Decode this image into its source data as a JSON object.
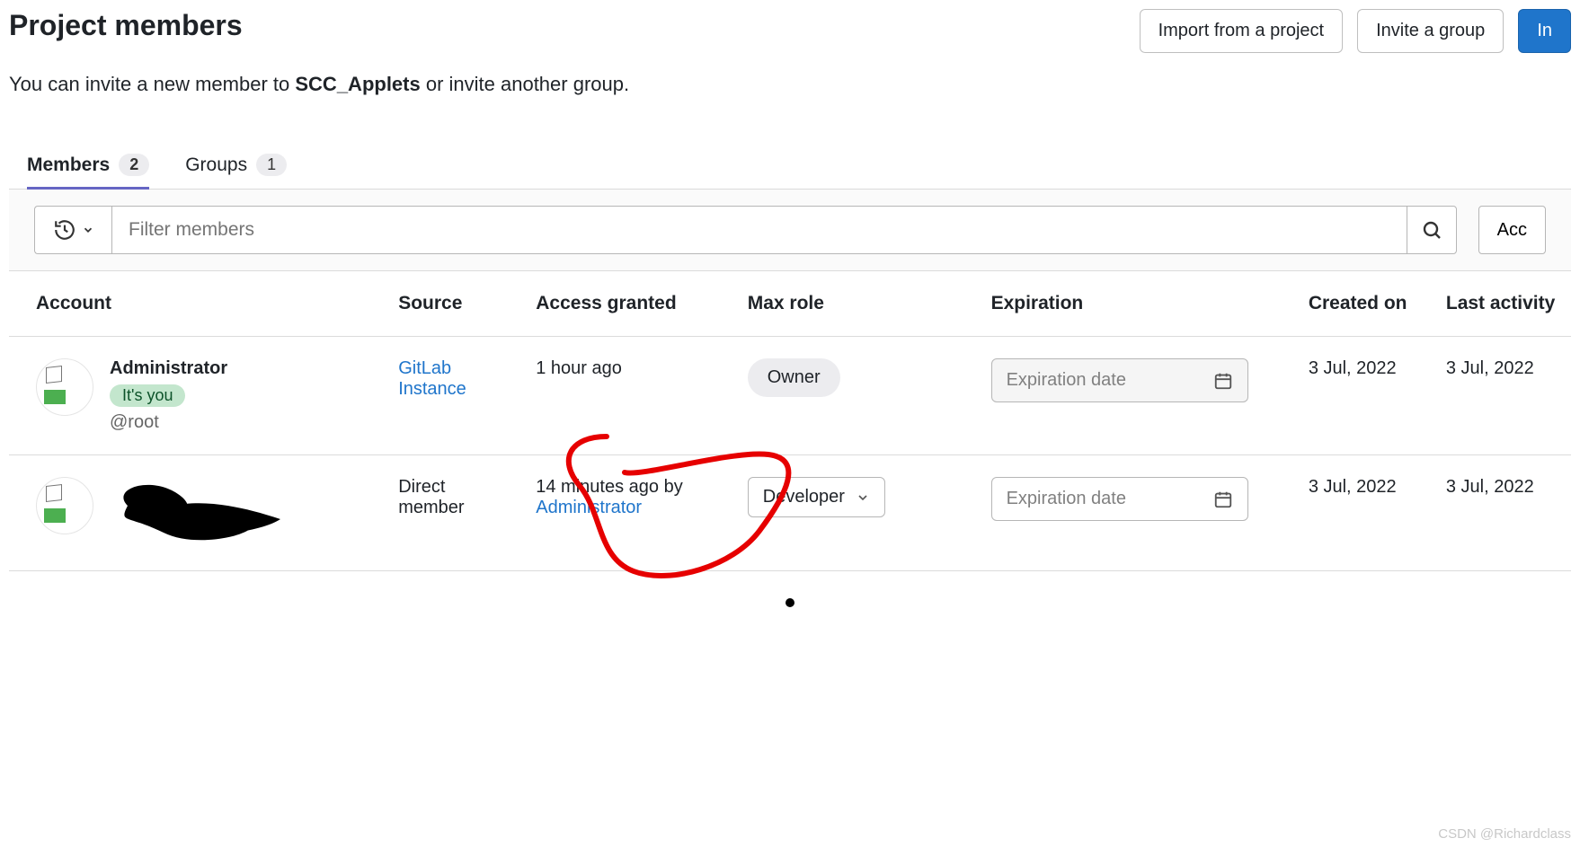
{
  "header": {
    "title": "Project members",
    "import_btn": "Import from a project",
    "invite_group_btn": "Invite a group",
    "invite_btn": "In"
  },
  "subtitle": {
    "pre": "You can invite a new member to ",
    "bold": "SCC_Applets",
    "post": " or invite another group."
  },
  "tabs": {
    "members_label": "Members",
    "members_count": "2",
    "groups_label": "Groups",
    "groups_count": "1"
  },
  "filter": {
    "placeholder": "Filter members",
    "sort_label": "Acc"
  },
  "columns": {
    "account": "Account",
    "source": "Source",
    "granted": "Access granted",
    "role": "Max role",
    "expiration": "Expiration",
    "created": "Created on",
    "last_activity": "Last activity"
  },
  "rows": [
    {
      "name": "Administrator",
      "its_you": "It's you",
      "username": "@root",
      "source": "GitLab Instance",
      "granted_text": "1 hour ago",
      "granted_by": "",
      "role_type": "pill",
      "role_text": "Owner",
      "exp_disabled": true,
      "exp_placeholder": "Expiration date",
      "created": "3 Jul, 2022",
      "last": "3 Jul, 2022"
    },
    {
      "name": "[redacted]",
      "its_you": "",
      "username": "",
      "source": "Direct member",
      "granted_text": "14 minutes ago by ",
      "granted_by": "Administrator",
      "role_type": "select",
      "role_text": "Developer",
      "exp_disabled": false,
      "exp_placeholder": "Expiration date",
      "created": "3 Jul, 2022",
      "last": "3 Jul, 2022"
    }
  ],
  "watermark": "CSDN @Richardclass"
}
